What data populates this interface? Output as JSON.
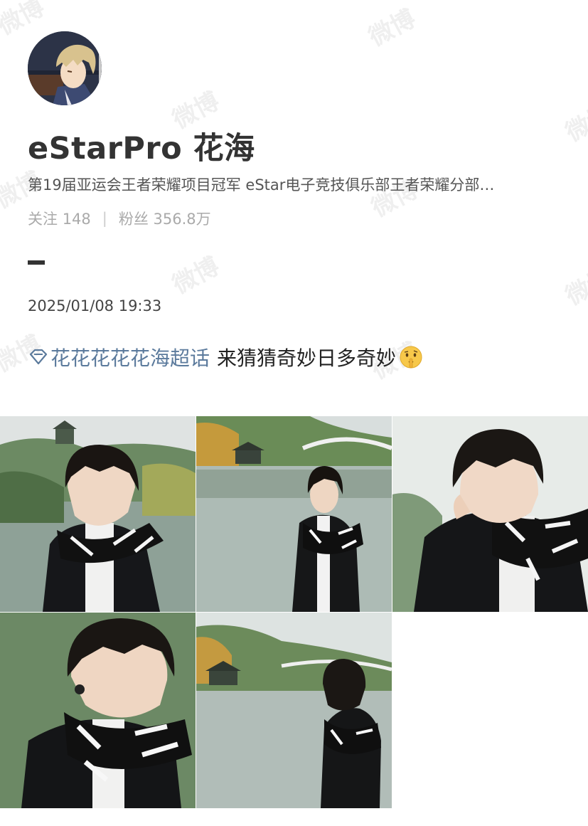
{
  "profile": {
    "name": "eStarPro 花海",
    "bio": "第19届亚运会王者荣耀项目冠军   eStar电子竞技俱乐部王者荣耀分部…",
    "following_label": "关注",
    "following_count": "148",
    "followers_label": "粉丝",
    "followers_count": "356.8万"
  },
  "post": {
    "timestamp": "2025/01/08 19:33",
    "topic": "花花花花花海超话",
    "text": "来猜猜奇妙日多奇妙"
  },
  "watermark": "微博",
  "icons": {
    "topic": "supertopic-diamond-icon",
    "emoji": "shush-thinking-emoji-icon"
  },
  "colors": {
    "topic_link": "#5b7a9c",
    "text": "#333333",
    "muted": "#aaaaaa"
  }
}
